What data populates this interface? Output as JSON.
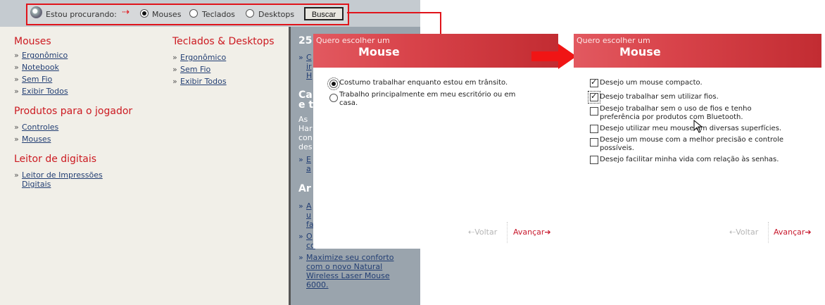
{
  "search": {
    "label": "Estou procurando:",
    "arrow": "⇢",
    "options": [
      "Mouses",
      "Teclados",
      "Desktops"
    ],
    "selected": "Mouses",
    "button_label": "Buscar"
  },
  "nav": {
    "col1": [
      {
        "title": "Mouses",
        "items": [
          "Ergonômico",
          "Notebook",
          "Sem Fio",
          "Exibir Todos"
        ]
      },
      {
        "title": "Produtos para o jogador",
        "items": [
          "Controles",
          "Mouses"
        ]
      },
      {
        "title": "Leitor de digitais",
        "items": [
          "Leitor de Impressões Digitais"
        ]
      }
    ],
    "col2": [
      {
        "title": "Teclados & Desktops",
        "items": [
          "Ergonômico",
          "Sem Fio",
          "Exibir Todos"
        ]
      }
    ]
  },
  "sidebar": {
    "heading1": "25",
    "block1_links": [
      "C",
      "ir",
      "H"
    ],
    "heading2_l1": "Ca",
    "heading2_l2": "e t",
    "para": [
      "As",
      "Har",
      "con",
      "des"
    ],
    "block2_links": [
      "E",
      "a"
    ],
    "heading3": "Ar",
    "block3_links": [
      "A",
      "u",
      "fa"
    ],
    "block4_links": [
      "O",
      "co"
    ],
    "feature_link": [
      "Maximize seu conforto",
      "com o novo Natural",
      "Wireless Laser Mouse",
      "6000."
    ]
  },
  "panel1": {
    "subtitle": "Quero escolher um",
    "title": "Mouse",
    "options": [
      {
        "text": [
          "Costumo trabalhar enquanto estou em trânsito."
        ],
        "selected": true
      },
      {
        "text": [
          "Trabalho principalmente em meu escritório ou em",
          "casa."
        ],
        "selected": false
      }
    ],
    "back_label": "Voltar",
    "next_label": "Avançar"
  },
  "panel2": {
    "subtitle": "Quero escolher um",
    "title": "Mouse",
    "options": [
      {
        "text": [
          "Desejo um mouse compacto."
        ],
        "checked": true
      },
      {
        "text": [
          "Desejo trabalhar sem utilizar fios."
        ],
        "checked": true
      },
      {
        "text": [
          "Desejo trabalhar sem o uso de fios e tenho",
          "preferência por produtos com Bluetooth."
        ],
        "checked": false
      },
      {
        "text": [
          "Desejo utilizar meu mouse em diversas superfícies."
        ],
        "checked": false
      },
      {
        "text": [
          "Desejo um mouse com a melhor precisão e controle",
          "possíveis."
        ],
        "checked": false
      },
      {
        "text": [
          "Desejo facilitar minha vida com relação às senhas."
        ],
        "checked": false
      }
    ],
    "back_label": "Voltar",
    "next_label": "Avançar"
  },
  "colors": {
    "accent_red": "#e0141b",
    "link_blue": "#223e73",
    "header_red": "#d8434a"
  },
  "icons": [
    "search-icon",
    "radio-icon",
    "checkbox-icon",
    "arrow-right-icon",
    "arrow-left-icon",
    "mouse-cursor-icon"
  ]
}
